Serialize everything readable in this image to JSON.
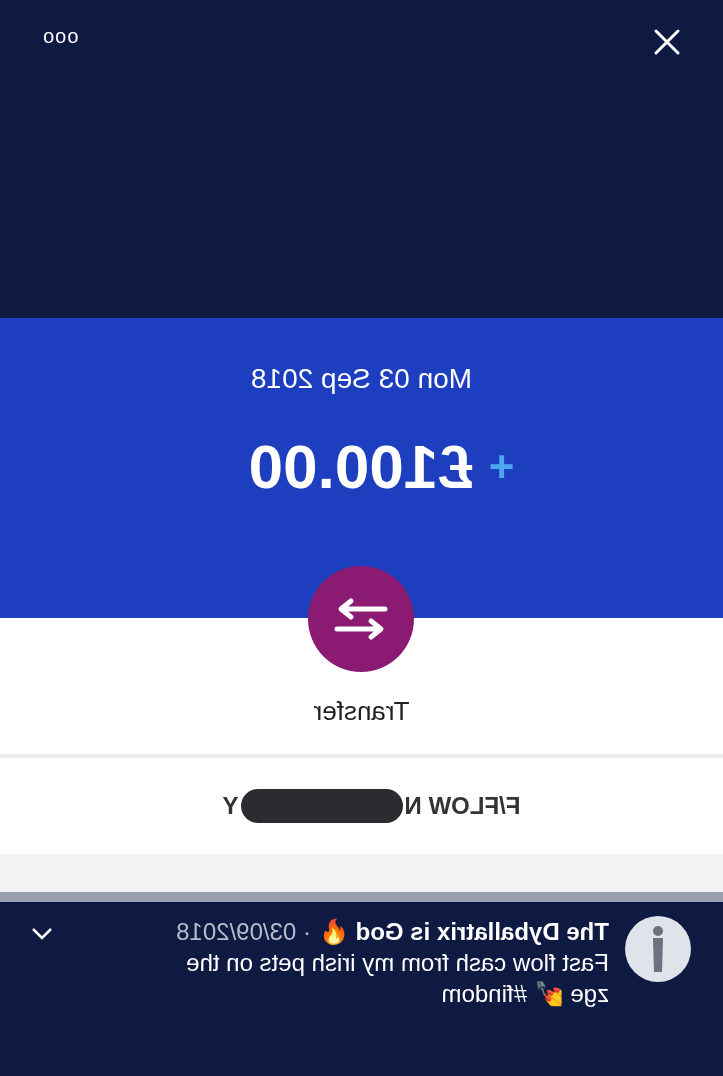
{
  "header": {
    "menu": "ooo"
  },
  "transaction": {
    "date": "Mon 03 Sep 2018",
    "sign": "+",
    "amount": "£100.00",
    "type": "Transfer"
  },
  "counterparty": {
    "name_start": "F/FLOW N",
    "name_end": "Y",
    "redacted": true
  },
  "notification": {
    "author": "The Dyballatrix is God 🔥",
    "date": "· 03/09/2018",
    "line_1": "Fast flow cash from my irish pets on the",
    "line_2": "zge 💅 #findom"
  }
}
